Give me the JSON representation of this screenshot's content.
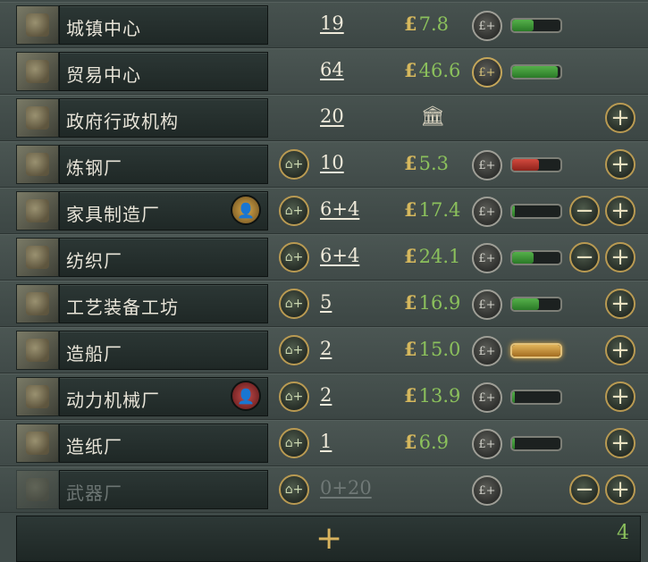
{
  "buildings": [
    {
      "name": "城镇中心",
      "level": "19",
      "money": "7.8",
      "bar": {
        "color": "green",
        "level": 0.45
      },
      "highlight_fin": false,
      "expand": false,
      "minus": false,
      "plus": false,
      "gov": false,
      "status": null,
      "dim": false
    },
    {
      "name": "贸易中心",
      "level": "64",
      "money": "46.6",
      "bar": {
        "color": "green",
        "level": 0.95
      },
      "highlight_fin": true,
      "expand": false,
      "minus": false,
      "plus": false,
      "gov": false,
      "status": null,
      "dim": false
    },
    {
      "name": "政府行政机构",
      "level": "20",
      "money": null,
      "bar": null,
      "highlight_fin": false,
      "expand": false,
      "minus": false,
      "plus": true,
      "gov": true,
      "status": null,
      "dim": false
    },
    {
      "name": "炼钢厂",
      "level": "10",
      "money": "5.3",
      "bar": {
        "color": "red",
        "level": 0.55
      },
      "highlight_fin": false,
      "expand": true,
      "minus": false,
      "plus": true,
      "gov": false,
      "status": null,
      "dim": false
    },
    {
      "name": "家具制造厂",
      "level": "6+4",
      "money": "17.4",
      "bar": {
        "color": "green",
        "level": 0.05
      },
      "highlight_fin": false,
      "expand": true,
      "minus": true,
      "plus": true,
      "gov": false,
      "status": "owner",
      "dim": false
    },
    {
      "name": "纺织厂",
      "level": "6+4",
      "money": "24.1",
      "bar": {
        "color": "green",
        "level": 0.45
      },
      "highlight_fin": false,
      "expand": true,
      "minus": true,
      "plus": true,
      "gov": false,
      "status": null,
      "dim": false
    },
    {
      "name": "工艺装备工坊",
      "level": "5",
      "money": "16.9",
      "bar": {
        "color": "green",
        "level": 0.55
      },
      "highlight_fin": false,
      "expand": true,
      "minus": false,
      "plus": true,
      "gov": false,
      "status": null,
      "dim": false
    },
    {
      "name": "造船厂",
      "level": "2",
      "money": "15.0",
      "bar": {
        "color": "orange",
        "level": 1.0
      },
      "highlight_fin": false,
      "expand": true,
      "minus": false,
      "plus": true,
      "gov": false,
      "status": null,
      "dim": false,
      "glow": true
    },
    {
      "name": "动力机械厂",
      "level": "2",
      "money": "13.9",
      "bar": {
        "color": "green",
        "level": 0.05
      },
      "highlight_fin": false,
      "expand": true,
      "minus": false,
      "plus": true,
      "gov": false,
      "status": "person",
      "dim": false
    },
    {
      "name": "造纸厂",
      "level": "1",
      "money": "6.9",
      "bar": {
        "color": "green",
        "level": 0.05
      },
      "highlight_fin": false,
      "expand": true,
      "minus": false,
      "plus": true,
      "gov": false,
      "status": null,
      "dim": false
    },
    {
      "name": "武器厂",
      "level": "0+20",
      "money": null,
      "bar": null,
      "highlight_fin": false,
      "expand": true,
      "minus": true,
      "plus": true,
      "gov": false,
      "status": null,
      "dim": true,
      "fin": true
    }
  ],
  "currency_symbol": "£",
  "fin_label": "£+",
  "expand_label": "⌂+",
  "gov_icon": "bank-icon",
  "footer": {
    "add_label": "+",
    "count": "4"
  }
}
